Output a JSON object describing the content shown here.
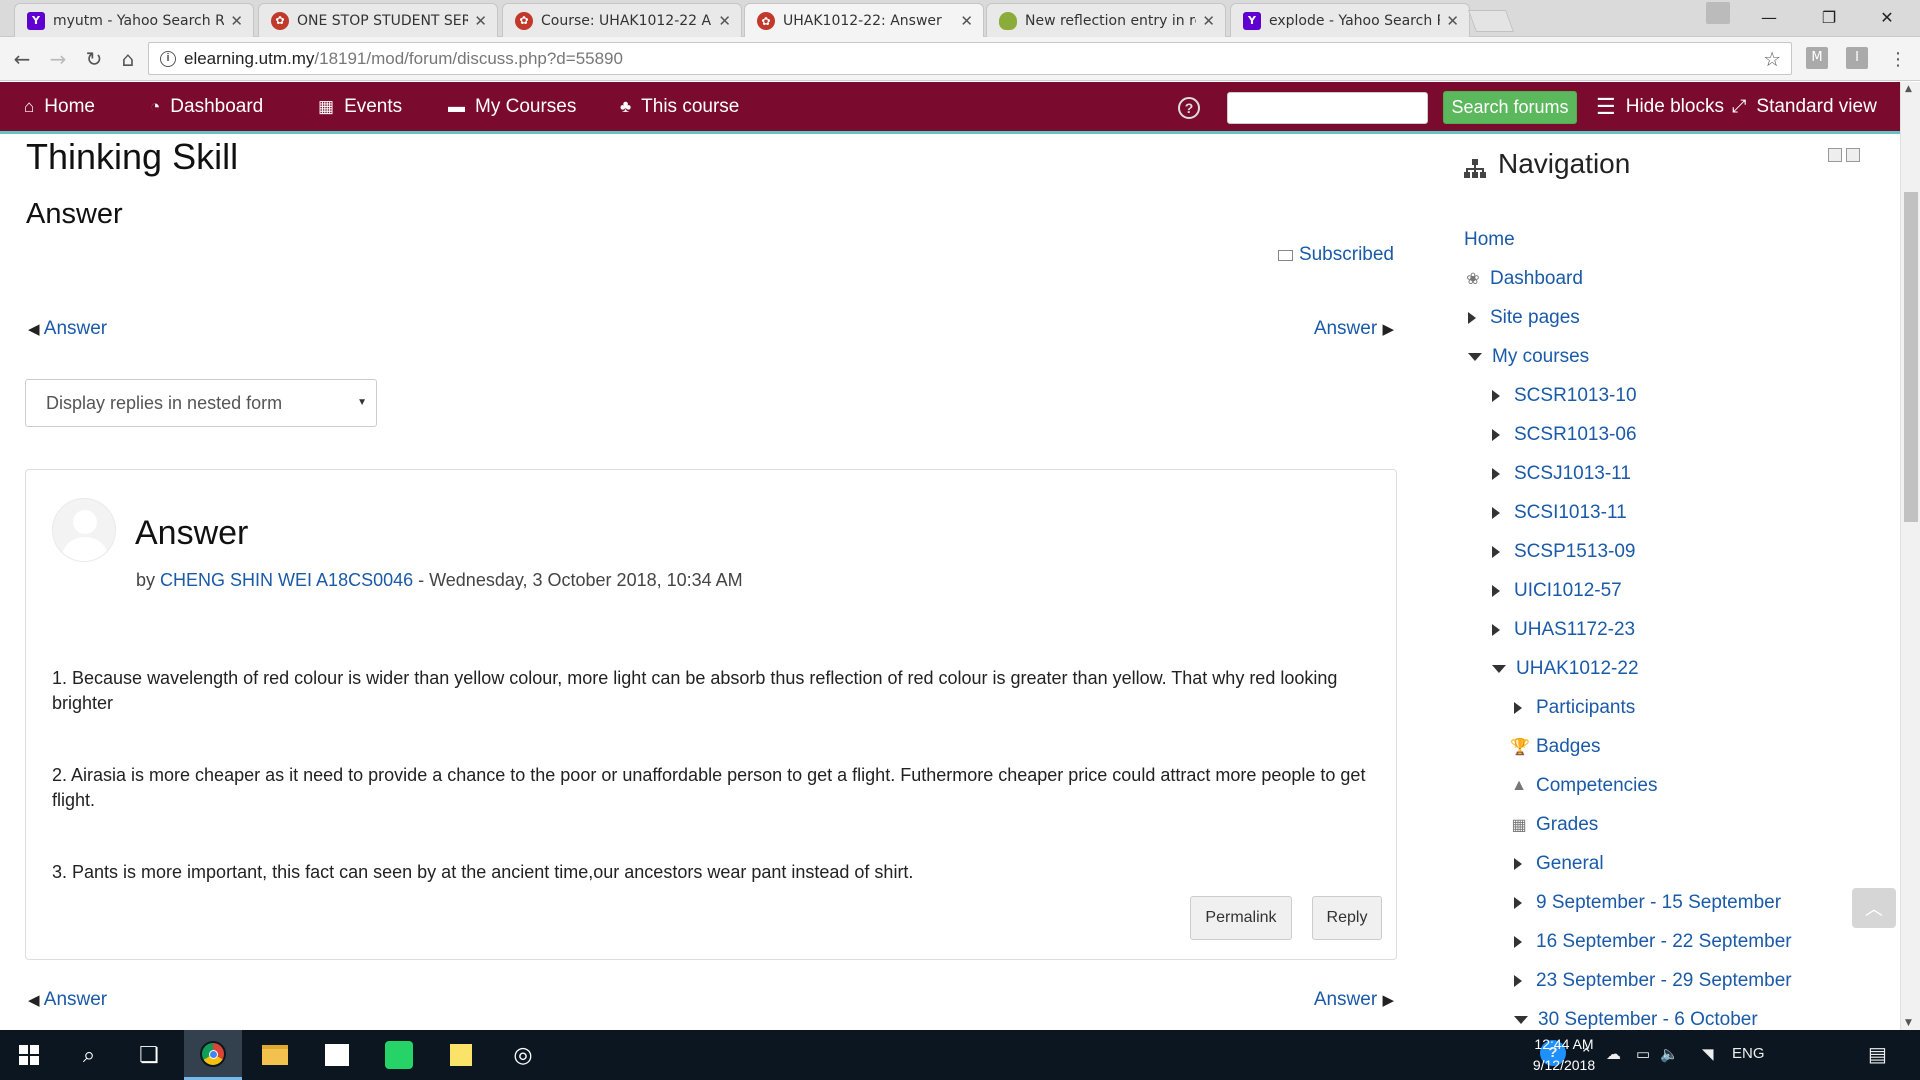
{
  "browser": {
    "tabs": [
      {
        "title": "myutm - Yahoo Search R",
        "favicon": "yahoo-favicon",
        "active": false
      },
      {
        "title": "ONE STOP STUDENT SER",
        "favicon": "utm-favicon",
        "active": false
      },
      {
        "title": "Course: UHAK1012-22 A",
        "favicon": "utm-favicon",
        "active": false
      },
      {
        "title": "UHAK1012-22: Answer",
        "favicon": "utm-favicon",
        "active": true
      },
      {
        "title": "New reflection entry in re",
        "favicon": "green-favicon",
        "active": false
      },
      {
        "title": "explode - Yahoo Search R",
        "favicon": "yahoo-favicon",
        "active": false
      }
    ],
    "url_host": "elearning.utm.my",
    "url_path": "/18191/mod/forum/discuss.php?d=55890",
    "extensions": [
      "M",
      "I"
    ]
  },
  "navbar": {
    "items": [
      {
        "label": "Home",
        "icon": "home-icon"
      },
      {
        "label": "Dashboard",
        "icon": "dashboard-icon"
      },
      {
        "label": "Events",
        "icon": "calendar-icon"
      },
      {
        "label": "My Courses",
        "icon": "briefcase-icon"
      },
      {
        "label": "This course",
        "icon": "sitemap-icon"
      }
    ],
    "search_button": "Search forums",
    "hide_blocks": "Hide blocks",
    "standard_view": "Standard view",
    "accent_color": "#7a0b2e"
  },
  "page": {
    "title": "Thinking Skill",
    "discussion_title": "Answer",
    "subscribed": "Subscribed",
    "prev_label": "Answer",
    "next_label": "Answer",
    "display_mode": "Display replies in nested form"
  },
  "post": {
    "subject": "Answer",
    "by": "by",
    "author": "CHENG SHIN WEI A18CS0046",
    "date": " - Wednesday, 3 October 2018, 10:34 AM",
    "paragraphs": [
      "1.  Because wavelength of red colour is wider than yellow colour, more light can be absorb thus  reflection of red colour is greater than yellow. That why red looking brighter",
      "2. Airasia is more cheaper as it need to provide a chance to the poor or unaffordable person to get a flight. Futhermore cheaper price could attract more people to get flight.",
      " 3. Pants is more important, this fact can seen by at the ancient time,our ancestors wear pant instead of shirt."
    ],
    "permalink": "Permalink",
    "reply": "Reply"
  },
  "navigation": {
    "title": "Navigation",
    "nodes": [
      {
        "label": "Home",
        "level": 0,
        "marker": "none"
      },
      {
        "label": "Dashboard",
        "level": 0,
        "marker": "dashboard-icon"
      },
      {
        "label": "Site pages",
        "level": 0,
        "marker": "collapsed"
      },
      {
        "label": "My courses",
        "level": 0,
        "marker": "expanded"
      },
      {
        "label": "SCSR1013-10",
        "level": 1,
        "marker": "collapsed"
      },
      {
        "label": "SCSR1013-06",
        "level": 1,
        "marker": "collapsed"
      },
      {
        "label": "SCSJ1013-11",
        "level": 1,
        "marker": "collapsed"
      },
      {
        "label": "SCSI1013-11",
        "level": 1,
        "marker": "collapsed"
      },
      {
        "label": "SCSP1513-09",
        "level": 1,
        "marker": "collapsed"
      },
      {
        "label": "UICI1012-57",
        "level": 1,
        "marker": "collapsed"
      },
      {
        "label": "UHAS1172-23",
        "level": 1,
        "marker": "collapsed"
      },
      {
        "label": "UHAK1012-22",
        "level": 1,
        "marker": "expanded"
      },
      {
        "label": "Participants",
        "level": 2,
        "marker": "collapsed"
      },
      {
        "label": "Badges",
        "level": 2,
        "marker": "trophy-icon"
      },
      {
        "label": "Competencies",
        "level": 2,
        "marker": "competency-icon"
      },
      {
        "label": "Grades",
        "level": 2,
        "marker": "grades-icon"
      },
      {
        "label": "General",
        "level": 2,
        "marker": "collapsed"
      },
      {
        "label": "9 September - 15 September",
        "level": 2,
        "marker": "collapsed"
      },
      {
        "label": "16 September - 22 September",
        "level": 2,
        "marker": "collapsed"
      },
      {
        "label": "23 September - 29 September",
        "level": 2,
        "marker": "collapsed"
      },
      {
        "label": "30 September - 6 October",
        "level": 2,
        "marker": "expanded"
      }
    ]
  },
  "taskbar": {
    "lang": "ENG",
    "time": "12:44 AM",
    "date": "9/12/2018"
  }
}
